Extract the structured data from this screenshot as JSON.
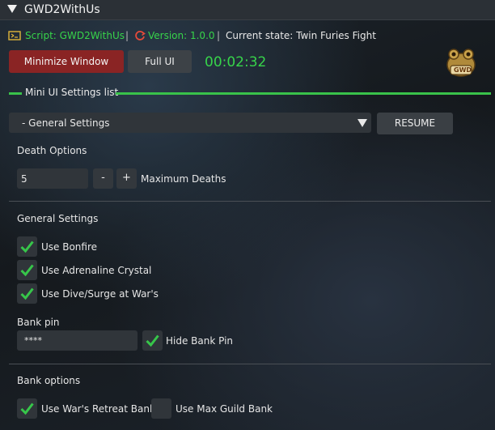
{
  "window": {
    "title": "GWD2WithUs"
  },
  "info": {
    "script_label": "Script: GWD2WithUs",
    "version_label": "Version: 1.0.0",
    "separator": "|",
    "state_label": "Current state: Twin Furies Fight"
  },
  "toolbar": {
    "minimize_label": "Minimize Window",
    "full_ui_label": "Full UI",
    "timer": "00:02:32"
  },
  "logo": {
    "text": "GWD"
  },
  "section": {
    "title": "Mini UI Settings list"
  },
  "dropdown": {
    "selected": "- General Settings"
  },
  "resume_label": "RESUME",
  "death_options": {
    "heading": "Death Options",
    "value": "5",
    "minus": "-",
    "plus": "+",
    "label": "Maximum Deaths"
  },
  "general_settings": {
    "heading": "General Settings",
    "items": [
      {
        "label": "Use Bonfire",
        "checked": true
      },
      {
        "label": "Use Adrenaline Crystal",
        "checked": true
      },
      {
        "label": "Use Dive/Surge at War's",
        "checked": true
      }
    ]
  },
  "bank_pin": {
    "heading": "Bank pin",
    "value": "****",
    "hide_label": "Hide Bank Pin",
    "hide_checked": true
  },
  "bank_options": {
    "heading": "Bank options",
    "items": [
      {
        "label": "Use War's Retreat Bank",
        "checked": true
      },
      {
        "label": "Use Max Guild Bank",
        "checked": false
      }
    ]
  },
  "colors": {
    "accent_green": "#37d44a",
    "minimize_red": "#8a2424",
    "section_line": "#39c24a"
  }
}
